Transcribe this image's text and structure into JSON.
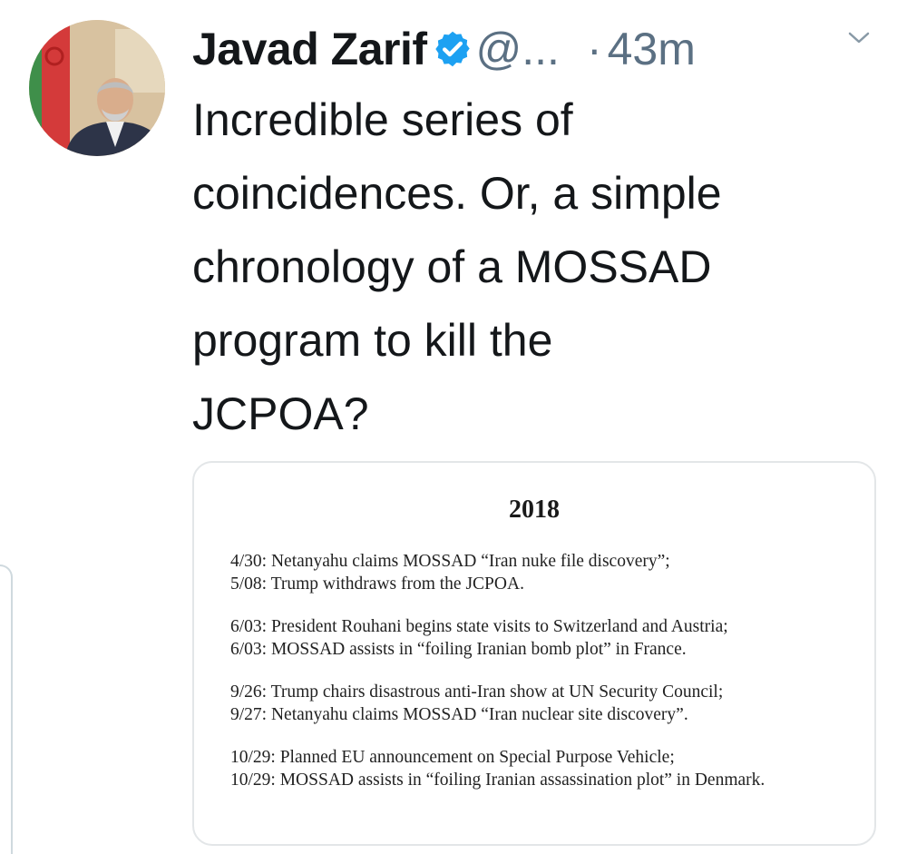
{
  "tweet": {
    "author_name": "Javad Zarif",
    "handle": "@...",
    "separator": "·",
    "time": "43m",
    "text": "Incredible series of\ncoincidences. Or, a simple\nchronology of a MOSSAD\nprogram to kill the\nJCPOA?"
  },
  "icons": {
    "verified": "verified-badge-icon",
    "menu": "chevron-down-icon"
  },
  "colors": {
    "verified_blue": "#1da1f2",
    "secondary_text": "#5b7083",
    "card_border": "#e3e6e8"
  },
  "image_card": {
    "title": "2018",
    "groups": [
      {
        "lines": [
          "4/30: Netanyahu claims MOSSAD “Iran nuke file discovery”;",
          "5/08: Trump withdraws from the JCPOA."
        ]
      },
      {
        "lines": [
          "6/03: President Rouhani begins state visits to Switzerland and Austria;",
          "6/03: MOSSAD assists in “foiling Iranian bomb plot” in France."
        ]
      },
      {
        "lines": [
          "9/26: Trump chairs disastrous anti-Iran show at UN Security Council;",
          "9/27: Netanyahu claims MOSSAD “Iran nuclear site discovery”."
        ]
      },
      {
        "lines": [
          "10/29: Planned EU announcement on Special Purpose Vehicle;",
          "10/29: MOSSAD assists in “foiling Iranian assassination plot” in Denmark."
        ]
      }
    ]
  }
}
